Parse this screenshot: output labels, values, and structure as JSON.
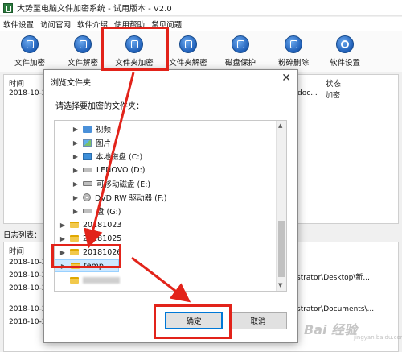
{
  "window": {
    "title": "大势至电脑文件加密系统 - 试用版本 - V2.0"
  },
  "menu": [
    "软件设置",
    "访问官网",
    "软件介绍",
    "使用帮助",
    "常见问题"
  ],
  "toolbar": [
    {
      "label": "文件加密",
      "icon": "file-lock-icon"
    },
    {
      "label": "文件解密",
      "icon": "file-unlock-icon"
    },
    {
      "label": "文件夹加密",
      "icon": "folder-lock-icon"
    },
    {
      "label": "文件夹解密",
      "icon": "folder-unlock-icon"
    },
    {
      "label": "磁盘保护",
      "icon": "disk-protect-icon"
    },
    {
      "label": "粉碎删除",
      "icon": "shred-icon"
    },
    {
      "label": "软件设置",
      "icon": "gear-icon"
    }
  ],
  "list": {
    "col_time": "时间",
    "col_status": "状态",
    "row_time": "2018-10-2",
    "row_path": "\\doc...",
    "row_status": "加密"
  },
  "log": {
    "label": "日志列表：",
    "col_time": "时间",
    "rows": [
      {
        "time": "2018-10-2",
        "path": ""
      },
      {
        "time": "2018-10-2",
        "path": "strator\\Desktop\\新..."
      },
      {
        "time": "2018-10-2",
        "path": ""
      },
      {
        "time": "2018-10-2",
        "path": "strator\\Documents\\..."
      },
      {
        "time": "2018-10-2",
        "path": ""
      }
    ]
  },
  "dialog": {
    "title": "浏览文件夹",
    "close": "✕",
    "prompt": "请选择要加密的文件夹：",
    "tree": [
      {
        "label": "视频",
        "icon": "video-folder-icon",
        "selected": false
      },
      {
        "label": "图片",
        "icon": "image-folder-icon",
        "selected": false
      },
      {
        "label": "本地磁盘 (C:)",
        "icon": "drive-icon",
        "selected": false
      },
      {
        "label": "LENOVO (D:)",
        "icon": "drive-icon",
        "selected": false
      },
      {
        "label": "可移动磁盘 (E:)",
        "icon": "drive-icon",
        "selected": false
      },
      {
        "label": "DVD RW 驱动器 (F:)",
        "icon": "disc-icon",
        "selected": false
      },
      {
        "label": "盘 (G:)",
        "icon": "drive-icon",
        "selected": false
      },
      {
        "label": "20181023",
        "icon": "folder-icon",
        "selected": false
      },
      {
        "label": "20181025",
        "icon": "folder-icon",
        "selected": false
      },
      {
        "label": "20181026",
        "icon": "folder-icon",
        "selected": false
      },
      {
        "label": "temp",
        "icon": "folder-icon",
        "selected": true
      }
    ],
    "ok": "确定",
    "cancel": "取消"
  },
  "watermark": {
    "text": "Bai 经验",
    "sub": "jingyan.baidu.com"
  },
  "annotation_color": "#e2231a"
}
